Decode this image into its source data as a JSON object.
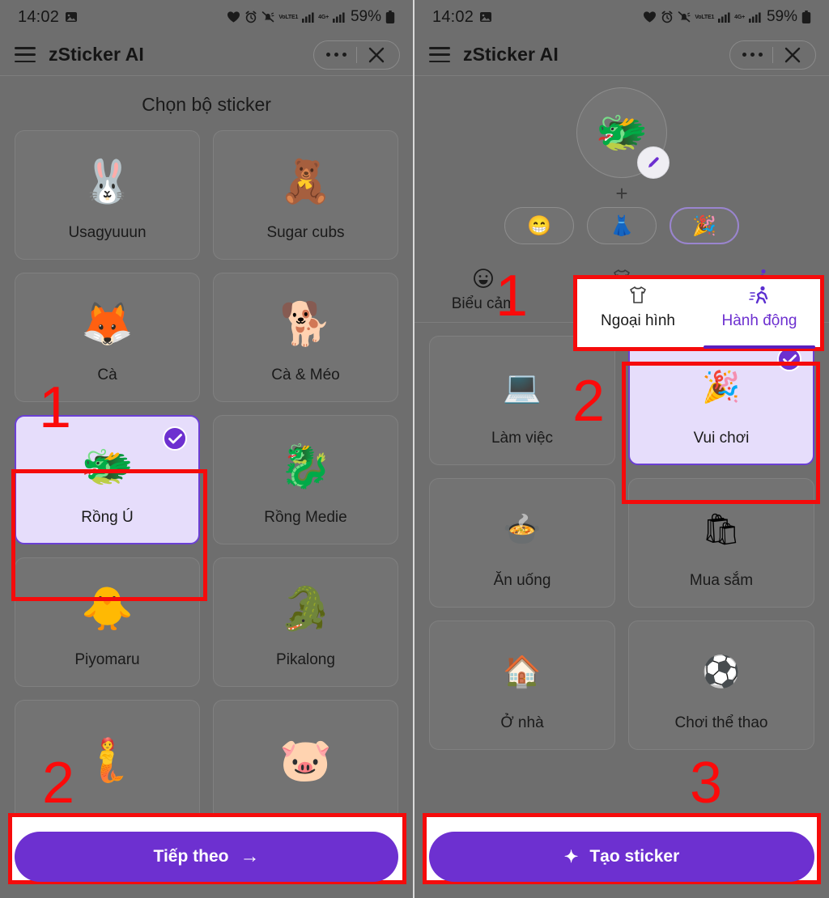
{
  "status_bar": {
    "time": "14:02",
    "battery_text": "59%",
    "network_label": "VoLTE1",
    "network_gen": "4G+",
    "icons": [
      "image-icon",
      "heart-icon",
      "alarm-icon",
      "mute-bell-icon",
      "volte-icon",
      "signal-bars-icon",
      "4g-plus-icon",
      "signal-bars-icon",
      "battery-icon"
    ]
  },
  "appbar": {
    "title": "zSticker AI",
    "menu_icon": "hamburger-icon",
    "more_icon": "more-dots-icon",
    "close_icon": "close-icon"
  },
  "left_panel": {
    "section_title": "Chọn bộ sticker",
    "cards": [
      {
        "label": "Usagyuuun",
        "art": "🐰",
        "selected": false
      },
      {
        "label": "Sugar cubs",
        "art": "🧸",
        "selected": false
      },
      {
        "label": "Cà",
        "art": "🦊",
        "selected": false
      },
      {
        "label": "Cà & Méo",
        "art": "🐕",
        "selected": false
      },
      {
        "label": "Rồng Ú",
        "art": "🐲",
        "selected": true
      },
      {
        "label": "Rồng Medie",
        "art": "🐉",
        "selected": false
      },
      {
        "label": "Piyomaru",
        "art": "🐥",
        "selected": false
      },
      {
        "label": "Pikalong",
        "art": "🐊",
        "selected": false
      },
      {
        "label": "",
        "art": "🧜",
        "selected": false
      },
      {
        "label": "",
        "art": "🐷",
        "selected": false
      }
    ],
    "cta_label": "Tiếp theo",
    "cta_arrow": "→",
    "annotations": [
      "1",
      "2"
    ]
  },
  "right_panel": {
    "avatar": {
      "art": "🐲",
      "edit_icon": "pencil-icon"
    },
    "plus": "+",
    "chips": [
      {
        "icon": "grinning-face-icon",
        "glyph": "😁",
        "active": false
      },
      {
        "icon": "dress-icon",
        "glyph": "👗",
        "active": false
      },
      {
        "icon": "party-popper-icon",
        "glyph": "🎉",
        "active": true
      }
    ],
    "tabs": [
      {
        "label": "Biểu cảm",
        "icon": "smiley-icon",
        "glyph": "☺",
        "active": false
      },
      {
        "label": "Ngoại hình",
        "icon": "tshirt-icon",
        "glyph": "👕",
        "active": false
      },
      {
        "label": "Hành động",
        "icon": "running-person-icon",
        "glyph": "🏃",
        "active": true
      }
    ],
    "cards": [
      {
        "label": "Làm việc",
        "icon": "laptop-icon",
        "glyph": "💻",
        "selected": false
      },
      {
        "label": "Vui chơi",
        "icon": "party-popper-icon",
        "glyph": "🎉",
        "selected": true
      },
      {
        "label": "Ăn uống",
        "icon": "cooking-pot-icon",
        "glyph": "🍲",
        "selected": false
      },
      {
        "label": "Mua sắm",
        "icon": "shopping-bags-icon",
        "glyph": "🛍",
        "selected": false
      },
      {
        "label": "Ở nhà",
        "icon": "house-icon",
        "glyph": "🏠",
        "selected": false
      },
      {
        "label": "Chơi thể thao",
        "icon": "soccer-ball-icon",
        "glyph": "⚽",
        "selected": false
      }
    ],
    "cta_label": "Tạo sticker",
    "cta_sparkle": "✦",
    "annotations": [
      "1",
      "2",
      "3"
    ]
  },
  "colors": {
    "accent_purple": "#6d30d0",
    "selected_bg": "#e6ddfb",
    "annotation_red": "#fb0a0a",
    "screen_bg": "#6e6e6e"
  }
}
